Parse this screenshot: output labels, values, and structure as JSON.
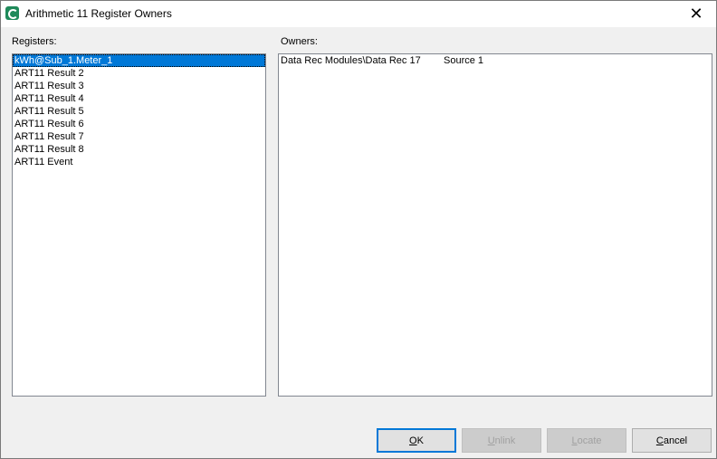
{
  "window": {
    "title": "Arithmetic 11 Register Owners",
    "close_glyph": "✕"
  },
  "registers": {
    "label": "Registers:",
    "items": [
      "kWh@Sub_1.Meter_1",
      "ART11 Result 2",
      "ART11 Result 3",
      "ART11 Result 4",
      "ART11 Result 5",
      "ART11 Result 6",
      "ART11 Result 7",
      "ART11 Result 8",
      "ART11 Event"
    ],
    "selected_index": 0
  },
  "owners": {
    "label": "Owners:",
    "rows": [
      {
        "module": "Data Rec Modules\\Data Rec 17",
        "input": "Source 1"
      }
    ]
  },
  "buttons": {
    "ok": {
      "label": "OK",
      "mnemonic": "O",
      "rest": "K"
    },
    "unlink": {
      "label": "Unlink",
      "mnemonic": "U",
      "rest": "nlink"
    },
    "locate": {
      "label": "Locate",
      "mnemonic": "L",
      "rest": "ocate"
    },
    "cancel": {
      "label": "Cancel",
      "mnemonic": "C",
      "rest": "ancel"
    }
  },
  "colors": {
    "selection": "#0078d7",
    "dialog_bg": "#f0f0f0"
  }
}
